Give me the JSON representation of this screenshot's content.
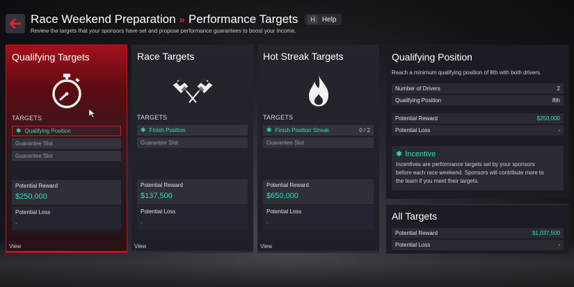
{
  "header": {
    "breadcrumb_1": "Race Weekend Preparation",
    "separator": "»",
    "breadcrumb_2": "Performance Targets",
    "help_key": "H",
    "help_label": "Help",
    "subtitle": "Review the targets that your sponsors have set and propose performance guarantees to boost your income."
  },
  "cards": [
    {
      "title": "Qualifying Targets",
      "icon": "stopwatch-icon",
      "targets_label": "TARGETS",
      "targets": [
        {
          "label": "Qualifying Position",
          "active": true
        },
        {
          "label": "Guarantee Slot",
          "active": false
        },
        {
          "label": "Guarantee Slot",
          "active": false
        }
      ],
      "reward_label": "Potential Reward",
      "reward_value": "$250,000",
      "loss_label": "Potential Loss",
      "loss_value": "-",
      "view_label": "View"
    },
    {
      "title": "Race Targets",
      "icon": "crossed-flags-icon",
      "targets_label": "TARGETS",
      "targets": [
        {
          "label": "Finish Position",
          "active": true
        },
        {
          "label": "Guarantee Slot",
          "active": false
        }
      ],
      "reward_label": "Potential Reward",
      "reward_value": "$137,500",
      "loss_label": "Potential Loss",
      "loss_value": "-",
      "view_label": "View"
    },
    {
      "title": "Hot Streak Targets",
      "icon": "flame-icon",
      "targets_label": "TARGETS",
      "targets": [
        {
          "label": "Finish Position Streak",
          "active": true,
          "progress": "0 / 2"
        },
        {
          "label": "Guarantee Slot",
          "active": false
        }
      ],
      "reward_label": "Potential Reward",
      "reward_value": "$650,000",
      "loss_label": "Potential Loss",
      "loss_value": "-",
      "view_label": "View"
    }
  ],
  "qualifying_position": {
    "title": "Qualifying Position",
    "description": "Reach a minimum qualifying position of 8th with both drivers.",
    "rows": [
      {
        "label": "Number of Drivers",
        "value": "2"
      },
      {
        "label": "Qualifying Position",
        "value": "8th"
      }
    ],
    "reward_label": "Potential Reward",
    "reward_value": "$250,000",
    "loss_label": "Potential Loss",
    "loss_value": "-",
    "incentive_title": "Incentive",
    "incentive_line_1": "Incentives are performance targets set by your sponsors",
    "incentive_line_2": "before each race weekend. Sponsors will contribute more to",
    "incentive_line_3": "the team if you meet their targets."
  },
  "all_targets": {
    "title": "All Targets",
    "reward_label": "Potential Reward",
    "reward_value": "$1,037,500",
    "loss_label": "Potential Loss",
    "loss_value": "-"
  },
  "colors": {
    "accent_red": "#c0141e",
    "success_teal": "#2fe0b8"
  }
}
